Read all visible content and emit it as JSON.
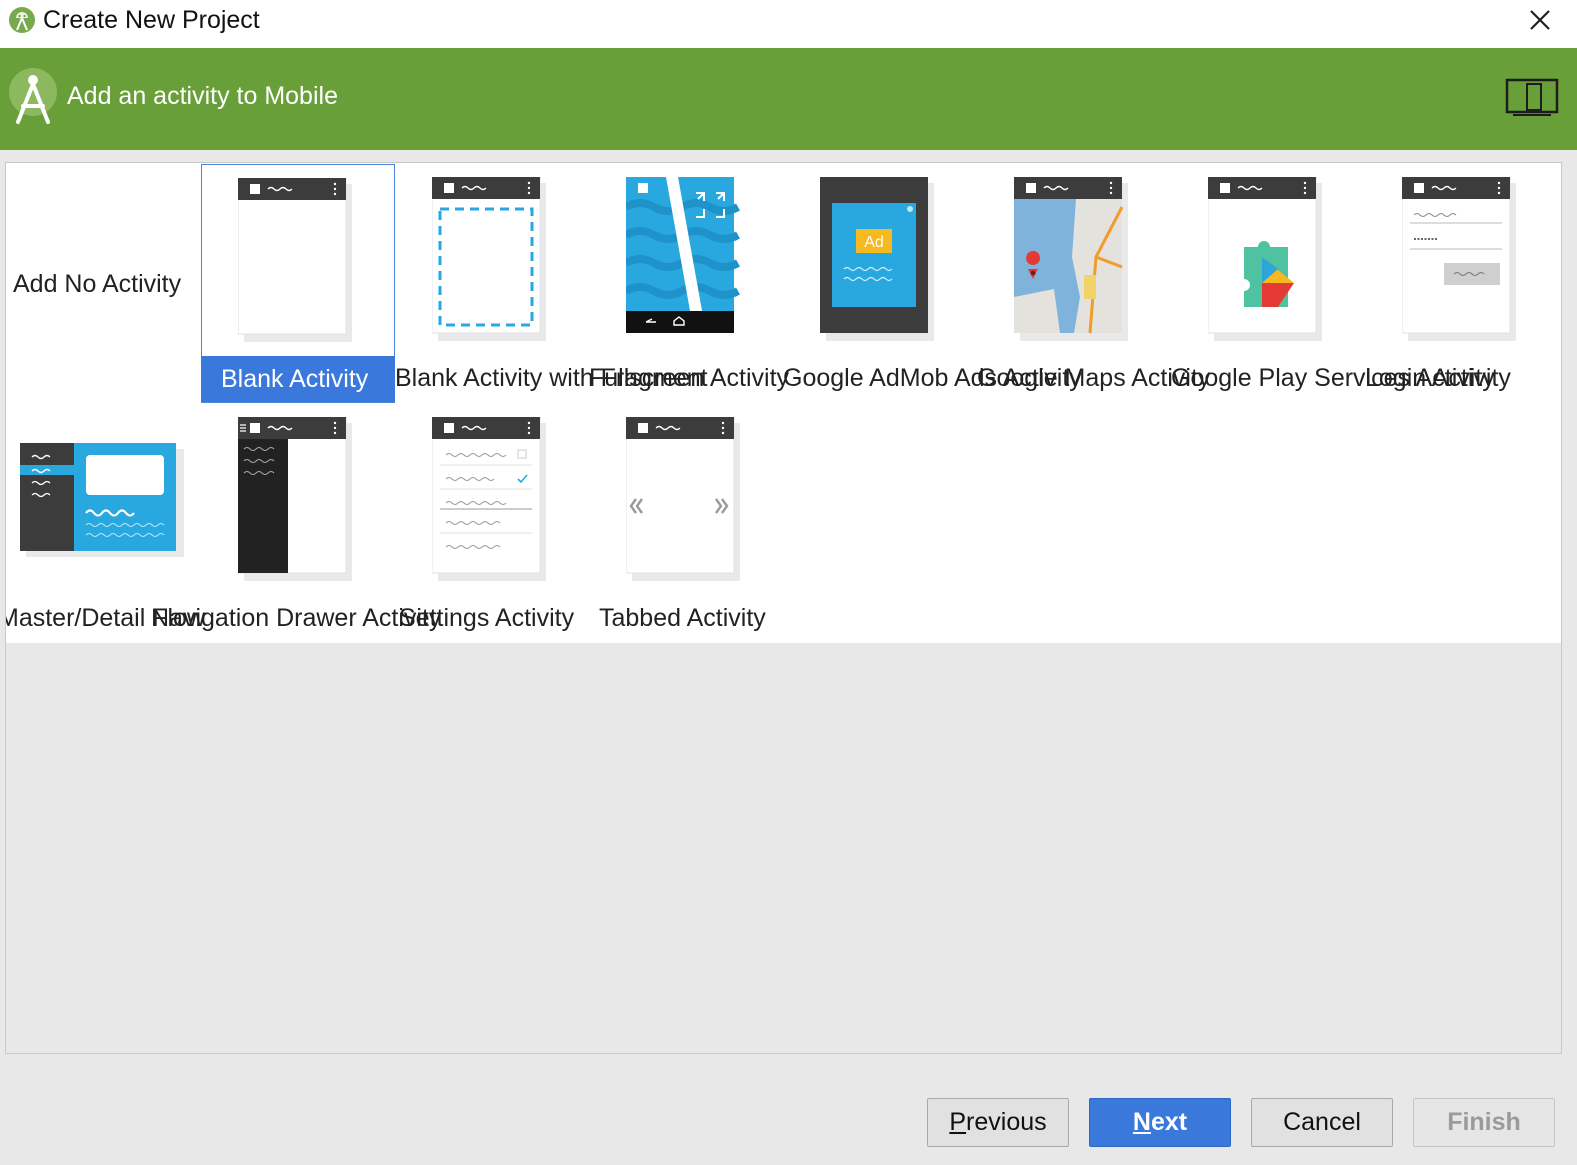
{
  "window": {
    "title": "Create New Project"
  },
  "banner": {
    "title": "Add an activity to Mobile"
  },
  "activities": [
    {
      "label": "Add No Activity",
      "thumb": "none"
    },
    {
      "label": "Blank Activity",
      "thumb": "blank",
      "selected": true
    },
    {
      "label": "Blank Activity with Fragment",
      "thumb": "fragment"
    },
    {
      "label": "Fullscreen Activity",
      "thumb": "fullscreen"
    },
    {
      "label": "Google AdMob Ads Activity",
      "thumb": "admob"
    },
    {
      "label": "Google Maps Activity",
      "thumb": "maps"
    },
    {
      "label": "Google Play Services Activity",
      "thumb": "play"
    },
    {
      "label": "Login Activity",
      "thumb": "login"
    },
    {
      "label": "Master/Detail Flow",
      "thumb": "masterdetail"
    },
    {
      "label": "Navigation Drawer Activity",
      "thumb": "navdrawer"
    },
    {
      "label": "Settings Activity",
      "thumb": "settings"
    },
    {
      "label": "Tabbed Activity",
      "thumb": "tabbed"
    }
  ],
  "ad_badge": "Ad",
  "buttons": {
    "previous": {
      "mnemonic": "P",
      "rest": "revious"
    },
    "next": {
      "mnemonic": "N",
      "rest": "ext"
    },
    "cancel": "Cancel",
    "finish": "Finish"
  },
  "colors": {
    "banner": "#689f38",
    "selection": "#3b78dc",
    "accent_blue": "#29a8e0"
  }
}
